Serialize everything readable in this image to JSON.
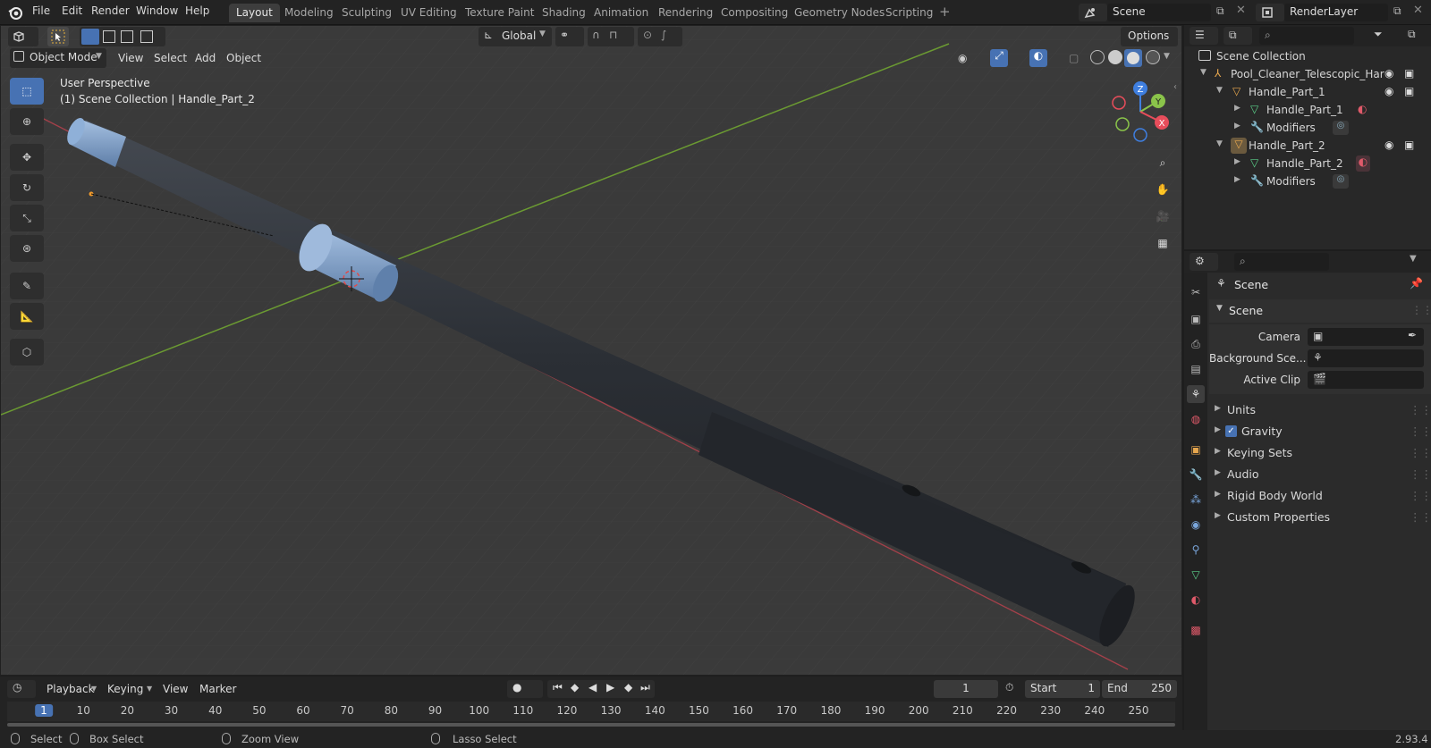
{
  "app": {
    "logo": "blender-logo-icon",
    "version": "2.93.4"
  },
  "menu": [
    "File",
    "Edit",
    "Render",
    "Window",
    "Help"
  ],
  "workspace_tabs": [
    "Layout",
    "Modeling",
    "Sculpting",
    "UV Editing",
    "Texture Paint",
    "Shading",
    "Animation",
    "Rendering",
    "Compositing",
    "Geometry Nodes",
    "Scripting"
  ],
  "active_workspace": "Layout",
  "scene_field": "Scene",
  "view_layer_field": "RenderLayer",
  "viewport": {
    "mode": "Object Mode",
    "menus": [
      "View",
      "Select",
      "Add",
      "Object"
    ],
    "orientation": "Global",
    "options_label": "Options",
    "overlay_line1": "User Perspective",
    "overlay_line2": "(1) Scene Collection | Handle_Part_2",
    "gizmo": {
      "x": "X",
      "y": "Y",
      "z": "Z"
    }
  },
  "outliner": {
    "root": "Scene Collection",
    "rows": [
      {
        "label": "Pool_Cleaner_Telescopic_Har",
        "icon": "empty-icon"
      },
      {
        "label": "Handle_Part_1",
        "icon": "mesh-object-icon"
      },
      {
        "label": "Handle_Part_1",
        "icon": "mesh-data-icon"
      },
      {
        "label": "Modifiers",
        "icon": "wrench-icon"
      },
      {
        "label": "Handle_Part_2",
        "icon": "mesh-object-icon"
      },
      {
        "label": "Handle_Part_2",
        "icon": "mesh-data-icon"
      },
      {
        "label": "Modifiers",
        "icon": "wrench-icon"
      }
    ]
  },
  "properties": {
    "header": "Scene",
    "panel_title": "Scene",
    "fields": [
      {
        "label": "Camera",
        "icon": "camera-object-icon"
      },
      {
        "label": "Background Sce...",
        "icon": "scene-icon"
      },
      {
        "label": "Active Clip",
        "icon": "clip-icon"
      }
    ],
    "sections": [
      "Units",
      "Gravity",
      "Keying Sets",
      "Audio",
      "Rigid Body World",
      "Custom Properties"
    ],
    "gravity_checked": true
  },
  "timeline": {
    "menus": [
      "Playback",
      "Keying",
      "View",
      "Marker"
    ],
    "current_frame": "1",
    "start_label": "Start",
    "start": "1",
    "end_label": "End",
    "end": "250",
    "ruler": [
      "1",
      "10",
      "20",
      "30",
      "40",
      "50",
      "60",
      "70",
      "80",
      "90",
      "100",
      "110",
      "120",
      "130",
      "140",
      "150",
      "160",
      "170",
      "180",
      "190",
      "200",
      "210",
      "220",
      "230",
      "240",
      "250"
    ]
  },
  "status": {
    "select": "Select",
    "box_select": "Box Select",
    "zoom_view": "Zoom View",
    "lasso_select": "Lasso Select"
  },
  "colors": {
    "accent": "#4772b3",
    "x_axis": "#e84d5b",
    "y_axis": "#8ac44a",
    "z_axis": "#3f7fe0",
    "cylinder": "#2b2f35",
    "knob": "#7e9fc7"
  }
}
